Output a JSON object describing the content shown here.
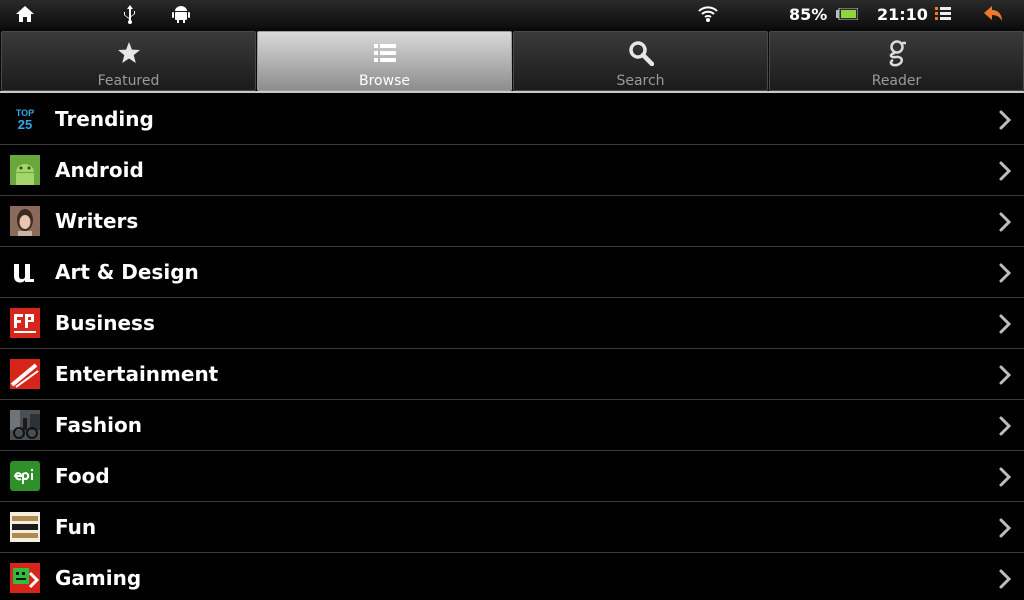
{
  "status_bar": {
    "icons": [
      "home-icon",
      "usb-icon",
      "android-debug-icon",
      "wifi-icon",
      "battery-icon",
      "notification-list-icon",
      "back-arrow-icon"
    ],
    "battery": "85%",
    "time": "21:10"
  },
  "tabs": [
    {
      "label": "Featured",
      "icon": "star-icon",
      "selected": false
    },
    {
      "label": "Browse",
      "icon": "list-icon",
      "selected": true
    },
    {
      "label": "Search",
      "icon": "search-icon",
      "selected": false
    },
    {
      "label": "Reader",
      "icon": "google-g-icon",
      "selected": false
    }
  ],
  "categories": [
    {
      "label": "Trending",
      "icon": "top25-icon"
    },
    {
      "label": "Android",
      "icon": "android-icon"
    },
    {
      "label": "Writers",
      "icon": "writer-portrait-icon"
    },
    {
      "label": "Art & Design",
      "icon": "u-logo-icon"
    },
    {
      "label": "Business",
      "icon": "fast-company-icon"
    },
    {
      "label": "Entertainment",
      "icon": "vanity-fair-icon"
    },
    {
      "label": "Fashion",
      "icon": "fashion-photo-icon"
    },
    {
      "label": "Food",
      "icon": "epi-icon"
    },
    {
      "label": "Fun",
      "icon": "cheezburger-icon"
    },
    {
      "label": "Gaming",
      "icon": "gaming-icon"
    }
  ],
  "colors": {
    "accent_battery": "#8ed63a",
    "back_arrow": "#f07a2a",
    "trending_blue": "#35a9e8",
    "epi_green": "#2f8f2b",
    "business_red": "#d6261c"
  }
}
